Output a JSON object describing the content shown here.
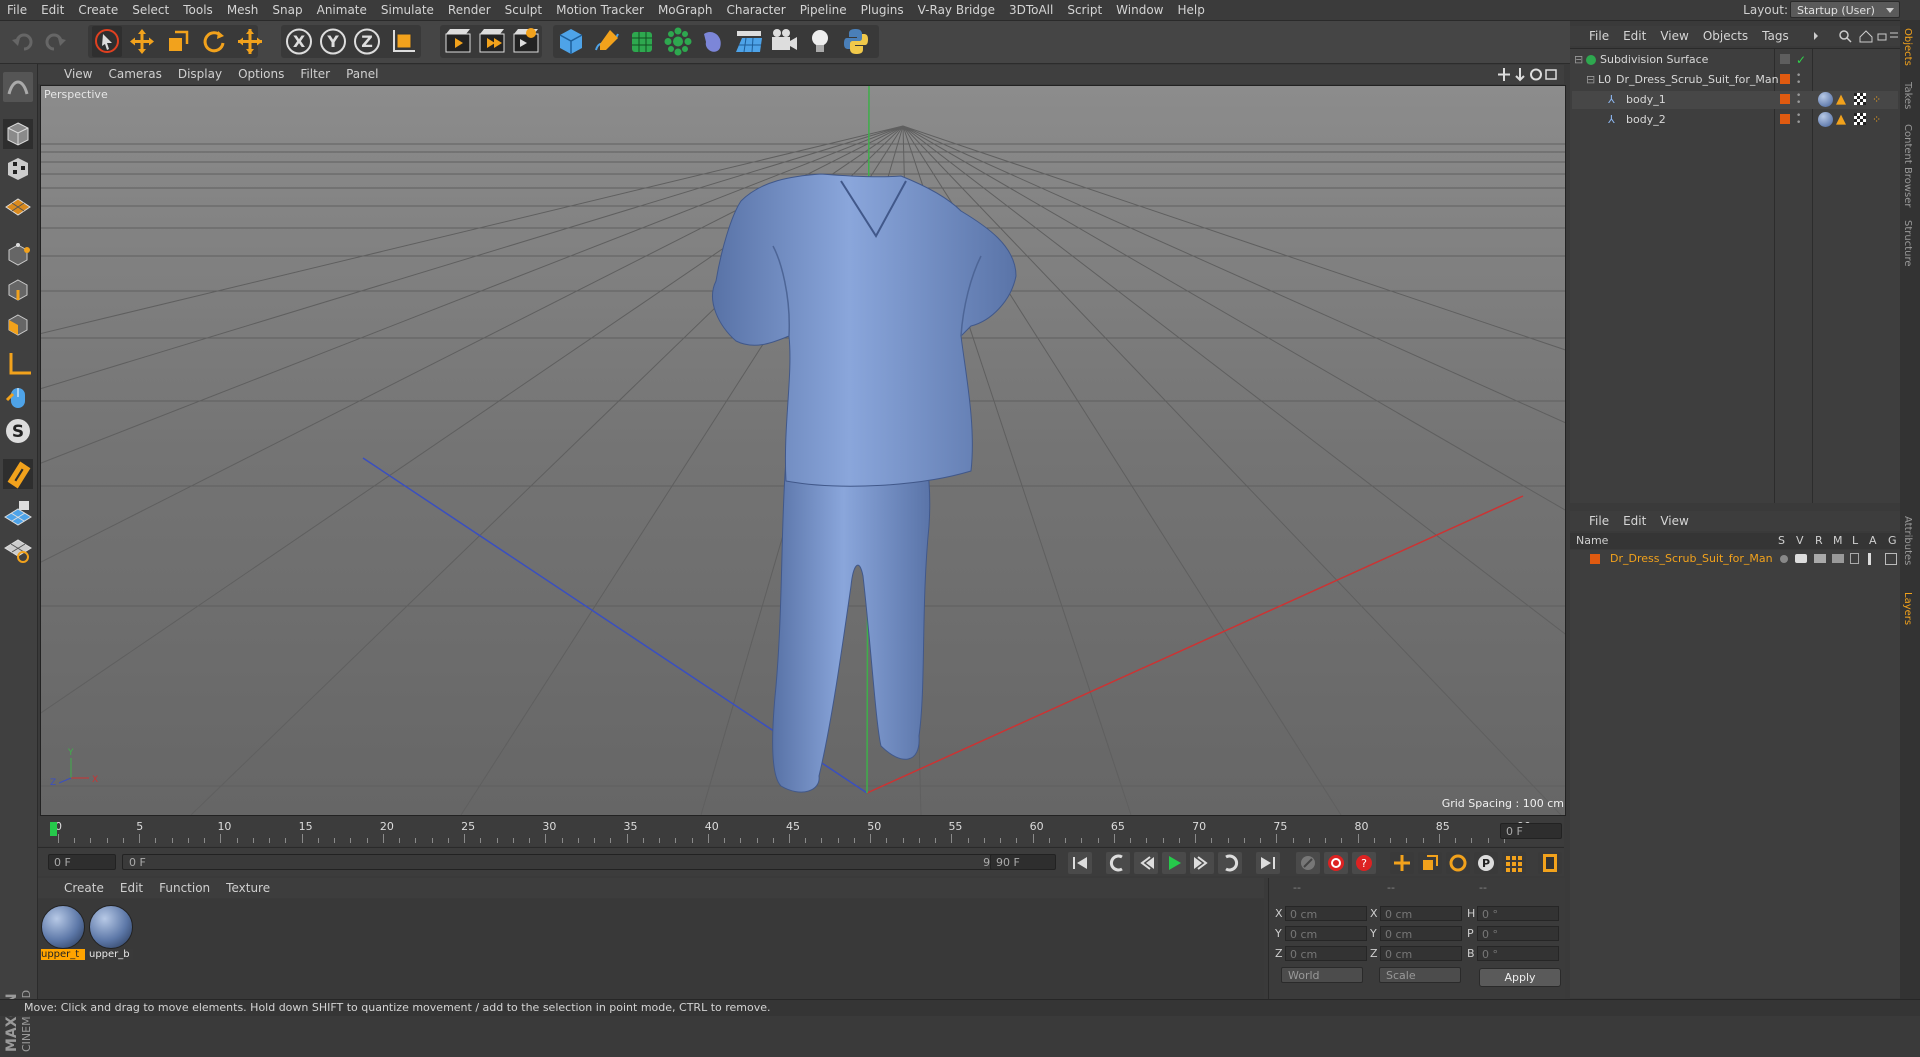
{
  "menu": [
    "File",
    "Edit",
    "Create",
    "Select",
    "Tools",
    "Mesh",
    "Snap",
    "Animate",
    "Simulate",
    "Render",
    "Sculpt",
    "Motion Tracker",
    "MoGraph",
    "Character",
    "Pipeline",
    "Plugins",
    "V-Ray Bridge",
    "3DToAll",
    "Script",
    "Window",
    "Help"
  ],
  "layout": {
    "label": "Layout:",
    "value": "Startup (User)"
  },
  "viewport": {
    "menu": [
      "View",
      "Cameras",
      "Display",
      "Options",
      "Filter",
      "Panel"
    ],
    "label": "Perspective",
    "grid_spacing": "Grid Spacing : 100 cm",
    "axis_x": "X",
    "axis_y": "Y",
    "axis_z": "Z"
  },
  "timeline": {
    "ticks": [
      "0",
      "5",
      "10",
      "15",
      "20",
      "25",
      "30",
      "35",
      "40",
      "45",
      "50",
      "55",
      "60",
      "65",
      "70",
      "75",
      "80",
      "85",
      "90"
    ],
    "end_frame": "0 F",
    "current": "0 F",
    "range_start": "0 F",
    "range_end": "90 F",
    "max_frame": "90 F"
  },
  "material_panel": {
    "menu": [
      "Create",
      "Edit",
      "Function",
      "Texture"
    ],
    "materials": [
      {
        "label": "upper_t",
        "selected": true
      },
      {
        "label": "upper_b",
        "selected": false
      }
    ]
  },
  "coordinates": {
    "header": [
      "--",
      "--",
      "--"
    ],
    "rows": [
      {
        "a": "X",
        "av": "0 cm",
        "b": "X",
        "bv": "0 cm",
        "c": "H",
        "cv": "0 °"
      },
      {
        "a": "Y",
        "av": "0 cm",
        "b": "Y",
        "bv": "0 cm",
        "c": "P",
        "cv": "0 °"
      },
      {
        "a": "Z",
        "av": "0 cm",
        "b": "Z",
        "bv": "0 cm",
        "c": "B",
        "cv": "0 °"
      }
    ],
    "mode1": "World",
    "mode2": "Scale",
    "apply": "Apply"
  },
  "status": "Move: Click and drag to move elements. Hold down SHIFT to quantize movement / add to the selection in point mode, CTRL to remove.",
  "object_manager": {
    "menu": [
      "File",
      "Edit",
      "View",
      "Objects",
      "Tags"
    ],
    "items": [
      {
        "name": "Subdivision Surface",
        "indent": 0
      },
      {
        "name": "Dr_Dress_Scrub_Suit_for_Man",
        "indent": 1
      },
      {
        "name": "body_1",
        "indent": 2
      },
      {
        "name": "body_2",
        "indent": 2
      }
    ]
  },
  "layer_manager": {
    "menu": [
      "File",
      "Edit",
      "View"
    ],
    "header": {
      "name": "Name",
      "cols": [
        "S",
        "V",
        "R",
        "M",
        "L",
        "A",
        "G"
      ]
    },
    "items": [
      {
        "name": "Dr_Dress_Scrub_Suit_for_Man"
      }
    ]
  },
  "side_tabs": [
    "Objects",
    "Takes",
    "Content Browser",
    "Structure",
    "Attributes",
    "Layers"
  ],
  "brand": "MAXON CINEMA 4D",
  "colors": {
    "accent": "#ffa400",
    "selection_orange": "#e07b00",
    "viewport_bg": "#686868",
    "garment": "#7592c9"
  }
}
